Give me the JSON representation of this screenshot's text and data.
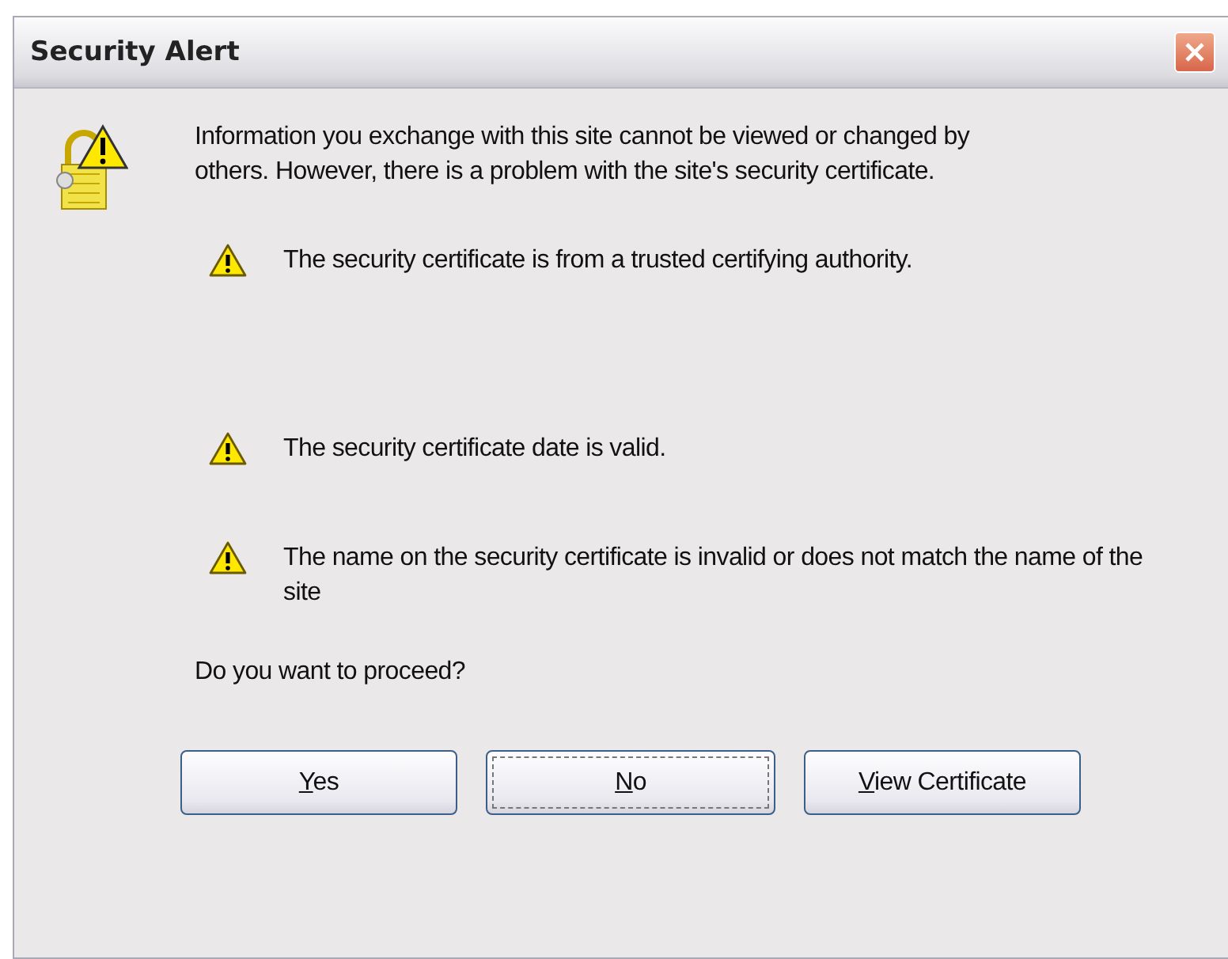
{
  "window": {
    "title": "Security Alert"
  },
  "message": "Information you exchange with this site cannot be viewed or changed by others. However, there is a problem with the site's security certificate.",
  "warnings": [
    {
      "text": "The security certificate is from a trusted certifying authority."
    },
    {
      "text": "The security certificate date is valid."
    },
    {
      "text": "The name on the security certificate is invalid or does not match the name of the site"
    }
  ],
  "question": "Do you want to proceed?",
  "buttons": [
    {
      "label": "Yes",
      "mnemonic": true,
      "focused": false
    },
    {
      "label": "No",
      "mnemonic": true,
      "focused": true
    },
    {
      "label": "View Certificate",
      "mnemonic": true,
      "focused": false
    }
  ]
}
